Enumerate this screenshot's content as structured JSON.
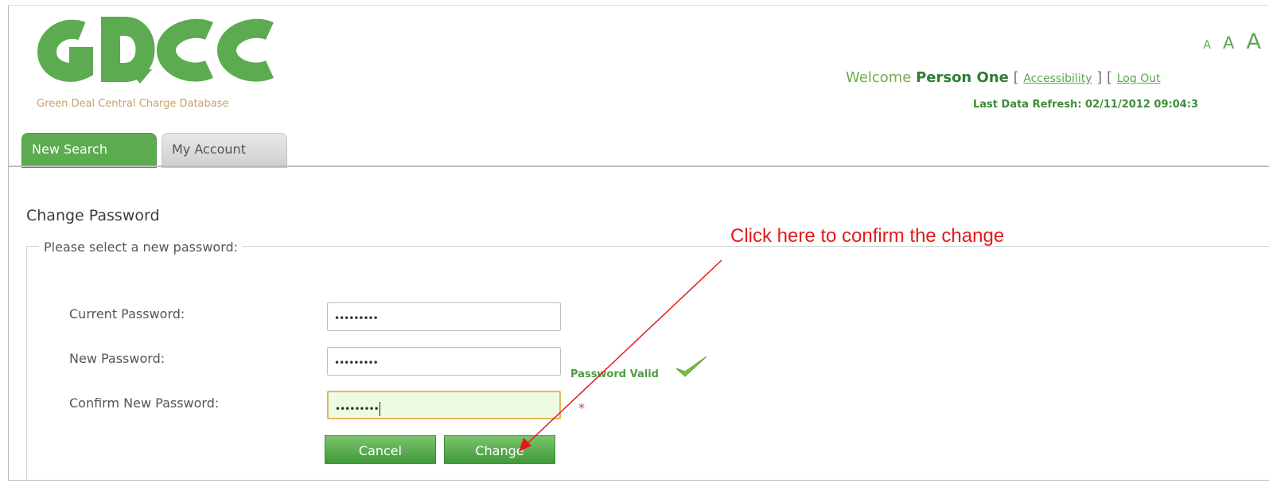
{
  "header": {
    "logo_text": "GDCC",
    "logo_subtitle": "Green Deal Central Charge Database",
    "font_sizes": [
      "A",
      "A",
      "A"
    ],
    "welcome_prefix": "Welcome",
    "user_name": "Person One",
    "accessibility_link": "Accessibility",
    "logout_link": "Log Out",
    "last_refresh": "Last Data Refresh: 02/11/2012 09:04:3",
    "brand_color": "#5cab50"
  },
  "tabs": [
    {
      "label": "New Search",
      "active": true
    },
    {
      "label": "My Account",
      "active": false
    }
  ],
  "form": {
    "title": "Change Password",
    "legend": "Please select a new password:",
    "fields": [
      {
        "label": "Current Password:",
        "value": "•••••••••"
      },
      {
        "label": "New Password:",
        "value": "•••••••••"
      },
      {
        "label": "Confirm New Password:",
        "value": "•••••••••"
      }
    ],
    "validation_message": "Password Valid",
    "required_marker": "*",
    "cancel_label": "Cancel",
    "change_label": "Change"
  },
  "annotation": {
    "text": "Click here to confirm the change",
    "color": "#e31a1a"
  }
}
